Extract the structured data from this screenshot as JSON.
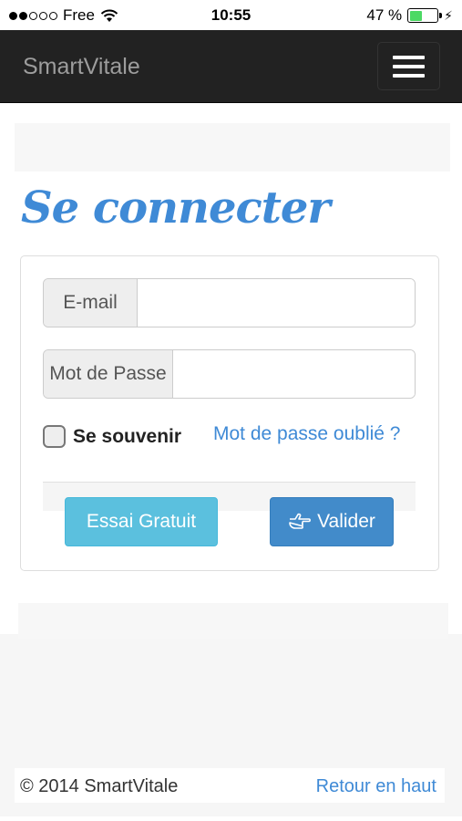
{
  "status_bar": {
    "carrier": "Free",
    "time": "10:55",
    "battery_percent": "47 %",
    "battery_level": 0.47,
    "signal_bars_filled": 2,
    "signal_bars_total": 5
  },
  "navbar": {
    "brand": "SmartVitale"
  },
  "login": {
    "title": "Se connecter",
    "email_label": "E-mail",
    "email_value": "",
    "password_label": "Mot de Passe",
    "password_value": "",
    "remember_label": "Se souvenir",
    "remember_checked": false,
    "forgot_link": "Mot de passe oublié ?",
    "trial_button": "Essai Gratuit",
    "submit_button": "Valider"
  },
  "footer": {
    "copyright": "© 2014 SmartVitale",
    "back_to_top": "Retour en haut"
  },
  "colors": {
    "navbar_bg": "#222222",
    "brand_text": "#9d9d9d",
    "accent_blue": "#3f8ad6",
    "trial_button": "#5bc0de",
    "submit_button": "#428bca",
    "battery_green": "#4cd964"
  }
}
